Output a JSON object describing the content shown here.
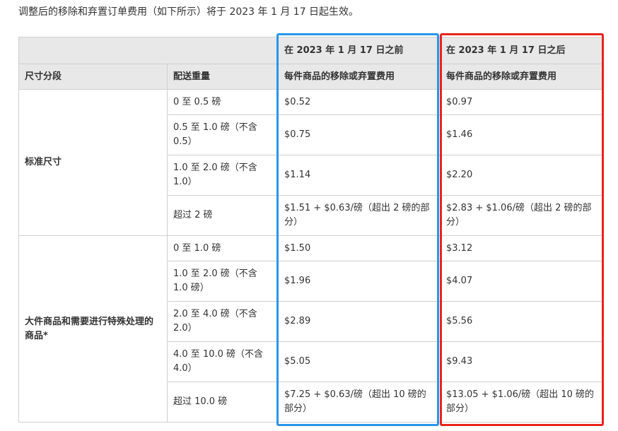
{
  "intro": "调整后的移除和弃置订单费用（如下所示）将于 2023 年 1 月 17 日起生效。",
  "header": {
    "before_label": "在 2023 年 1 月 17 日之前",
    "after_label": "在 2023 年 1 月 17 日之后",
    "col_tier": "尺寸分段",
    "col_weight": "配送重量",
    "col_fee_before": "每件商品的移除或弃置费用",
    "col_fee_after": "每件商品的移除或弃置费用"
  },
  "tiers": {
    "standard": "标准尺寸",
    "oversize": "大件商品和需要进行特殊处理的商品*"
  },
  "rows": [
    {
      "weight": "0 至 0.5 磅",
      "before": "$0.52",
      "after": "$0.97"
    },
    {
      "weight": "0.5 至 1.0 磅（不含 0.5）",
      "before": "$0.75",
      "after": "$1.46"
    },
    {
      "weight": "1.0 至 2.0 磅（不含 1.0）",
      "before": "$1.14",
      "after": "$2.20"
    },
    {
      "weight": "超过 2 磅",
      "before": "$1.51 + $0.63/磅（超出 2 磅的部分）",
      "after": "$2.83 + $1.06/磅（超出 2 磅的部分）"
    },
    {
      "weight": "0 至 1.0 磅",
      "before": "$1.50",
      "after": "$3.12"
    },
    {
      "weight": "1.0 至 2.0 磅（不含 1.0 磅）",
      "before": "$1.96",
      "after": "$4.07"
    },
    {
      "weight": "2.0 至 4.0 磅（不含 2.0）",
      "before": "$2.89",
      "after": "$5.56"
    },
    {
      "weight": "4.0 至 10.0 磅（不含 4.0）",
      "before": "$5.05",
      "after": "$9.43"
    },
    {
      "weight": "超过 10.0 磅",
      "before": "$7.25 + $0.63/磅（超出 10 磅的部分）",
      "after": "$13.05 + $1.06/磅（超出 10 磅的部分）"
    }
  ],
  "colors": {
    "highlight_before": "#2a96e8",
    "highlight_after": "#e8231c",
    "header_bg": "#e8e8e8",
    "border": "#cfcfcf"
  }
}
